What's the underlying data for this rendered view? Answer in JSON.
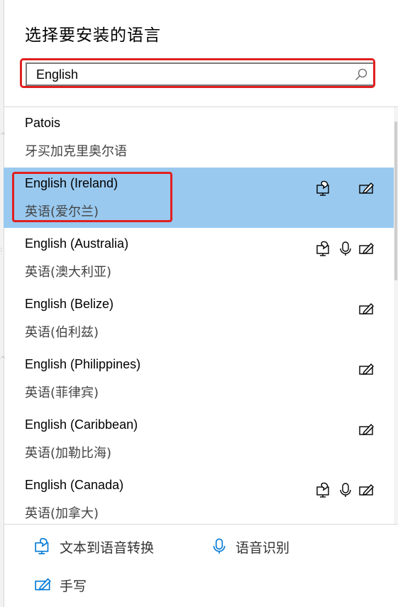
{
  "dialog": {
    "title": "选择要安装的语言",
    "search": {
      "value": "English",
      "placeholder": ""
    }
  },
  "languages": [
    {
      "name": "Patois",
      "native": "牙买加克里奥尔语",
      "features": [],
      "selected": false
    },
    {
      "name": "English (Ireland)",
      "native": "英语(爱尔兰)",
      "features": [
        "text-to-speech",
        "handwriting"
      ],
      "selected": true
    },
    {
      "name": "English (Australia)",
      "native": "英语(澳大利亚)",
      "features": [
        "text-to-speech",
        "speech-recognition",
        "handwriting"
      ],
      "selected": false
    },
    {
      "name": "English (Belize)",
      "native": "英语(伯利兹)",
      "features": [
        "handwriting"
      ],
      "selected": false
    },
    {
      "name": "English (Philippines)",
      "native": "英语(菲律宾)",
      "features": [
        "handwriting"
      ],
      "selected": false
    },
    {
      "name": "English (Caribbean)",
      "native": "英语(加勒比海)",
      "features": [
        "handwriting"
      ],
      "selected": false
    },
    {
      "name": "English (Canada)",
      "native": "英语(加拿大)",
      "features": [
        "text-to-speech",
        "speech-recognition",
        "handwriting"
      ],
      "selected": false
    }
  ],
  "legend": {
    "text_to_speech": "文本到语音转换",
    "speech_recognition": "语音识别",
    "handwriting": "手写"
  },
  "colors": {
    "selected_row": "#99c9ef",
    "highlight_outline": "#e02020",
    "accent": "#0078d7"
  }
}
